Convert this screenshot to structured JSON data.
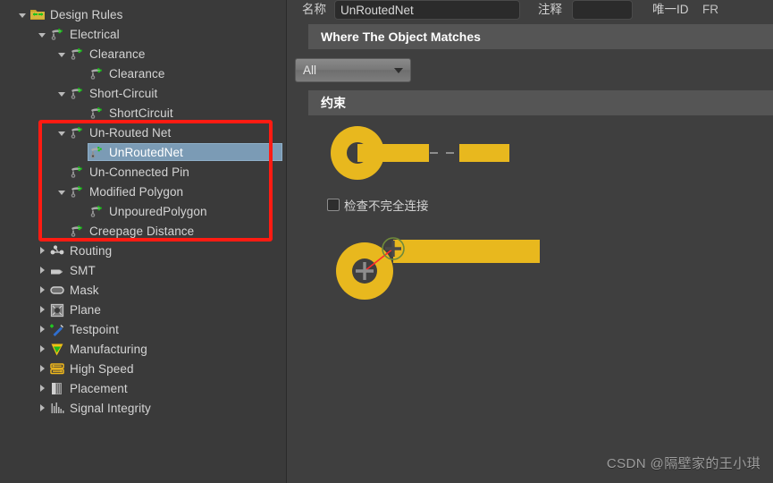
{
  "tree": {
    "title": "Design Rules",
    "items": [
      {
        "label": "Design Rules",
        "depth": 0,
        "twisty": "expanded",
        "icon": "design-rules-folder-icon",
        "selected": false
      },
      {
        "label": "Electrical",
        "depth": 1,
        "twisty": "expanded",
        "icon": "rule-icon",
        "selected": false
      },
      {
        "label": "Clearance",
        "depth": 2,
        "twisty": "expanded",
        "icon": "rule-icon",
        "selected": false
      },
      {
        "label": "Clearance",
        "depth": 3,
        "twisty": "none",
        "icon": "rule-icon",
        "selected": false
      },
      {
        "label": "Short-Circuit",
        "depth": 2,
        "twisty": "expanded",
        "icon": "rule-icon",
        "selected": false
      },
      {
        "label": "ShortCircuit",
        "depth": 3,
        "twisty": "none",
        "icon": "rule-icon",
        "selected": false
      },
      {
        "label": "Un-Routed Net",
        "depth": 2,
        "twisty": "expanded",
        "icon": "rule-icon",
        "selected": false
      },
      {
        "label": "UnRoutedNet",
        "depth": 3,
        "twisty": "none",
        "icon": "rule-icon",
        "selected": true
      },
      {
        "label": "Un-Connected Pin",
        "depth": 2,
        "twisty": "none",
        "icon": "rule-icon",
        "selected": false
      },
      {
        "label": "Modified Polygon",
        "depth": 2,
        "twisty": "expanded",
        "icon": "rule-icon",
        "selected": false
      },
      {
        "label": "UnpouredPolygon",
        "depth": 3,
        "twisty": "none",
        "icon": "rule-icon",
        "selected": false
      },
      {
        "label": "Creepage Distance",
        "depth": 2,
        "twisty": "none",
        "icon": "rule-icon",
        "selected": false
      },
      {
        "label": "Routing",
        "depth": 1,
        "twisty": "collapsed",
        "icon": "routing-icon",
        "selected": false
      },
      {
        "label": "SMT",
        "depth": 1,
        "twisty": "collapsed",
        "icon": "smt-icon",
        "selected": false
      },
      {
        "label": "Mask",
        "depth": 1,
        "twisty": "collapsed",
        "icon": "mask-icon",
        "selected": false
      },
      {
        "label": "Plane",
        "depth": 1,
        "twisty": "collapsed",
        "icon": "plane-icon",
        "selected": false
      },
      {
        "label": "Testpoint",
        "depth": 1,
        "twisty": "collapsed",
        "icon": "testpoint-icon",
        "selected": false
      },
      {
        "label": "Manufacturing",
        "depth": 1,
        "twisty": "collapsed",
        "icon": "manufacturing-icon",
        "selected": false
      },
      {
        "label": "High Speed",
        "depth": 1,
        "twisty": "collapsed",
        "icon": "high-speed-icon",
        "selected": false
      },
      {
        "label": "Placement",
        "depth": 1,
        "twisty": "collapsed",
        "icon": "placement-icon",
        "selected": false
      },
      {
        "label": "Signal Integrity",
        "depth": 1,
        "twisty": "collapsed",
        "icon": "signal-integrity-icon",
        "selected": false
      }
    ]
  },
  "annotation": {
    "color": "#ff1b12",
    "shape": "rectangle"
  },
  "fields": {
    "name_label": "名称",
    "name_value": "UnRoutedNet",
    "comment_label": "注释",
    "comment_value": "",
    "comment_placeholder": "",
    "unique_id_label": "唯一ID",
    "truncated_label": "FR"
  },
  "sections": {
    "where_title": "Where The Object Matches",
    "constraint_title": "约束"
  },
  "scope": {
    "selected": "All",
    "options": [
      "All"
    ]
  },
  "constraint": {
    "checkbox_label": "检查不完全连接",
    "checked": false,
    "pad_color": "#e8b81e",
    "track_color": "#e8b81e",
    "ratline_color": "#ff2a2a",
    "marker_color": "#4a4a4a"
  },
  "watermark": {
    "text": "CSDN @隔壁家的王小琪"
  }
}
